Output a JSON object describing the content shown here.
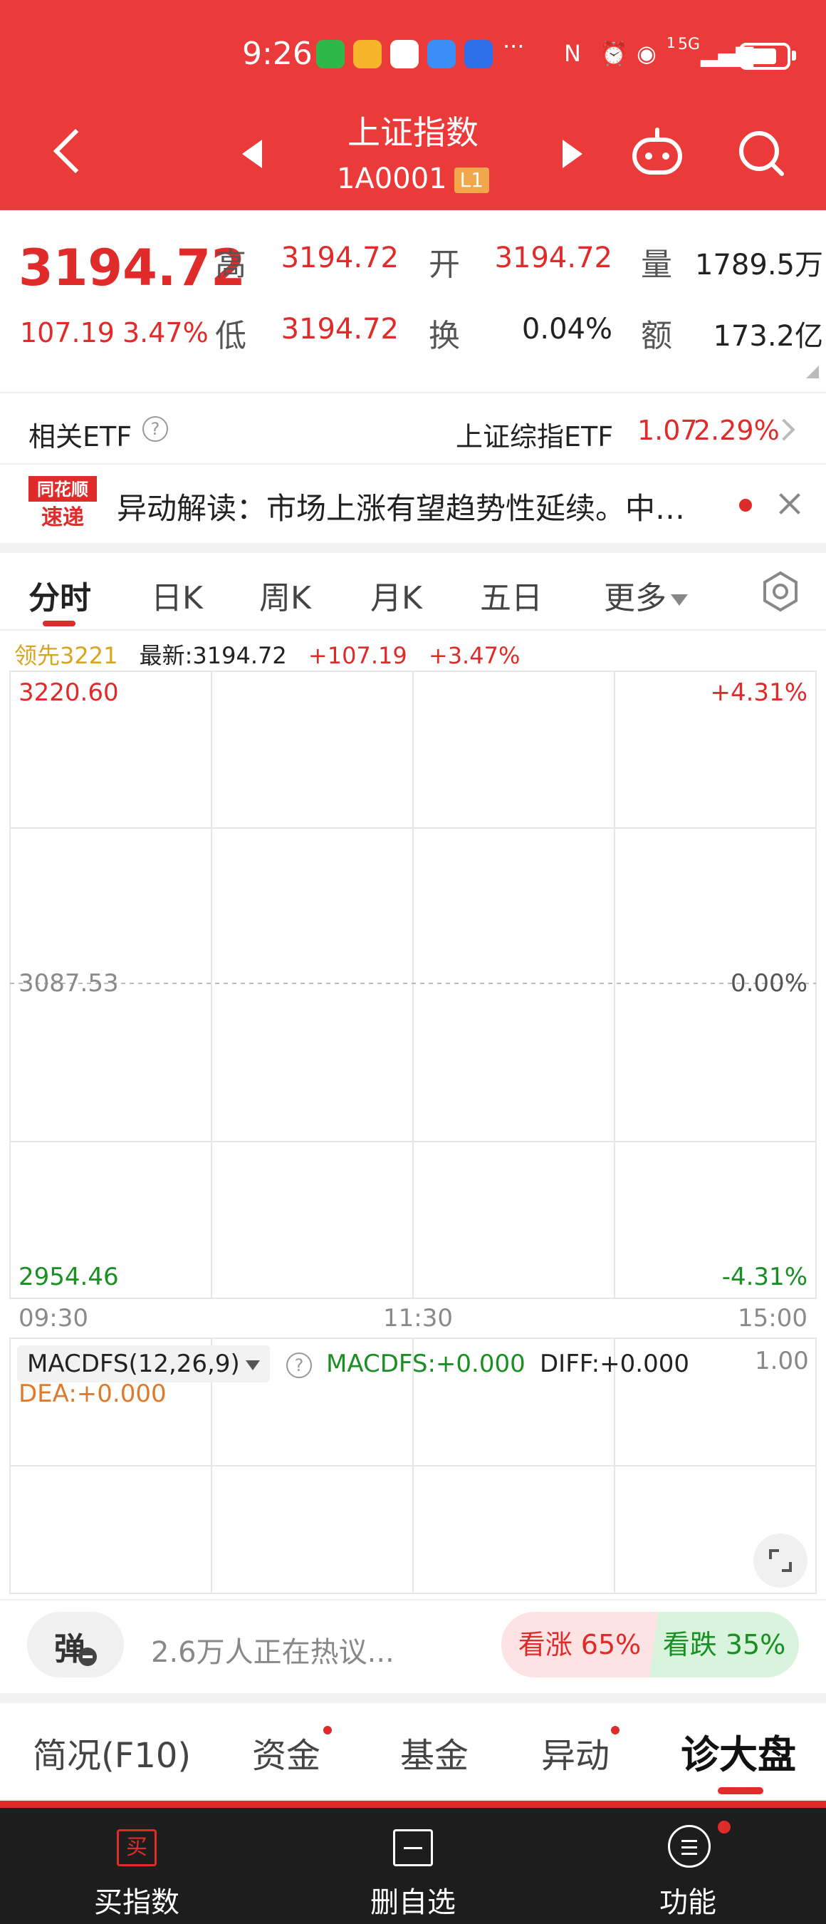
{
  "status_bar": {
    "time": "9:26",
    "sim_label": "1",
    "network": "5G"
  },
  "header": {
    "title": "上证指数",
    "code": "1A0001",
    "level": "L1"
  },
  "quote": {
    "price": "3194.72",
    "change": "107.19",
    "change_pct": "3.47%",
    "high_label": "高",
    "high": "3194.72",
    "open_label": "开",
    "open": "3194.72",
    "volume_label": "量",
    "volume": "1789.5万",
    "low_label": "低",
    "low": "3194.72",
    "turnover_label": "换",
    "turnover": "0.04%",
    "amount_label": "额",
    "amount": "173.2亿"
  },
  "etf": {
    "label": "相关ETF",
    "help": "?",
    "name": "上证综指ETF",
    "price": "1.07",
    "pct": "2.29%"
  },
  "news": {
    "logo_top": "同花顺",
    "logo_bottom": "速递",
    "text": "异动解读：市场上涨有望趋势性延续。中…"
  },
  "chart_tabs": [
    {
      "label": "分时"
    },
    {
      "label": "日K"
    },
    {
      "label": "周K"
    },
    {
      "label": "月K"
    },
    {
      "label": "五日"
    },
    {
      "label": "更多"
    }
  ],
  "info_line": {
    "leader": "领先3221",
    "latest": "最新:3194.72",
    "change": "+107.19",
    "pct": "+3.47%"
  },
  "chart_data": {
    "type": "line",
    "series": [],
    "ylim": [
      2954.46,
      3220.6
    ],
    "y_left_ticks": [
      "3220.60",
      "3087.53",
      "2954.46"
    ],
    "y_right_ticks": [
      "+4.31%",
      "0.00%",
      "-4.31%"
    ],
    "x_ticks": [
      "09:30",
      "11:30",
      "15:00"
    ],
    "reference": 3087.53,
    "grid": true
  },
  "macd": {
    "selector": "MACDFS(12,26,9)",
    "help": "?",
    "macdfs": "MACDFS:+0.000",
    "diff": "DIFF:+0.000",
    "dea": "DEA:+0.000",
    "scale": "1.00"
  },
  "discussion": {
    "danmu": "弹",
    "text": "2.6万人正在热议...",
    "bull": "看涨 65%",
    "bear": "看跌 35%",
    "bull_pct": 65,
    "bear_pct": 35
  },
  "bottom_tabs": [
    {
      "label": "简况(F10)"
    },
    {
      "label": "资金"
    },
    {
      "label": "基金"
    },
    {
      "label": "异动"
    },
    {
      "label": "诊大盘"
    }
  ],
  "actions": {
    "buy": "买指数",
    "buy_icon": "买",
    "remove": "删自选",
    "menu": "功能"
  },
  "colors": {
    "brand_red": "#ea3a3a",
    "up": "#e02b2b",
    "down": "#1a8f24"
  }
}
